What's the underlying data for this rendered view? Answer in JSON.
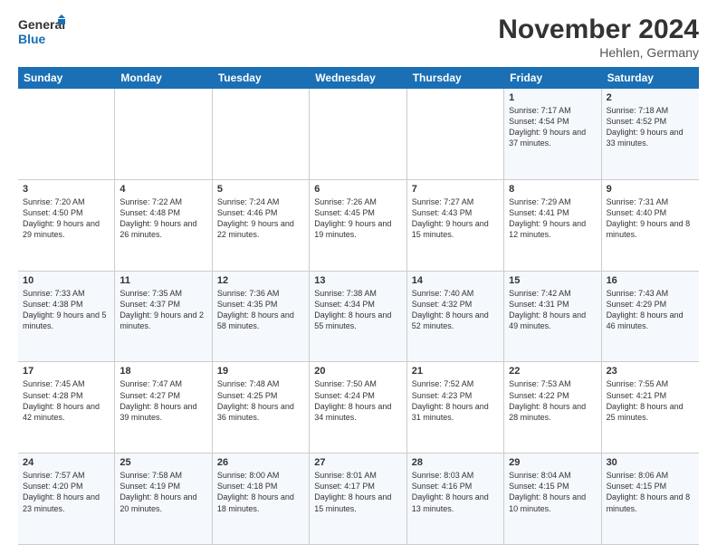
{
  "logo": {
    "line1": "General",
    "line2": "Blue"
  },
  "title": "November 2024",
  "location": "Hehlen, Germany",
  "headers": [
    "Sunday",
    "Monday",
    "Tuesday",
    "Wednesday",
    "Thursday",
    "Friday",
    "Saturday"
  ],
  "rows": [
    [
      {
        "day": "",
        "info": ""
      },
      {
        "day": "",
        "info": ""
      },
      {
        "day": "",
        "info": ""
      },
      {
        "day": "",
        "info": ""
      },
      {
        "day": "",
        "info": ""
      },
      {
        "day": "1",
        "info": "Sunrise: 7:17 AM\nSunset: 4:54 PM\nDaylight: 9 hours and 37 minutes."
      },
      {
        "day": "2",
        "info": "Sunrise: 7:18 AM\nSunset: 4:52 PM\nDaylight: 9 hours and 33 minutes."
      }
    ],
    [
      {
        "day": "3",
        "info": "Sunrise: 7:20 AM\nSunset: 4:50 PM\nDaylight: 9 hours and 29 minutes."
      },
      {
        "day": "4",
        "info": "Sunrise: 7:22 AM\nSunset: 4:48 PM\nDaylight: 9 hours and 26 minutes."
      },
      {
        "day": "5",
        "info": "Sunrise: 7:24 AM\nSunset: 4:46 PM\nDaylight: 9 hours and 22 minutes."
      },
      {
        "day": "6",
        "info": "Sunrise: 7:26 AM\nSunset: 4:45 PM\nDaylight: 9 hours and 19 minutes."
      },
      {
        "day": "7",
        "info": "Sunrise: 7:27 AM\nSunset: 4:43 PM\nDaylight: 9 hours and 15 minutes."
      },
      {
        "day": "8",
        "info": "Sunrise: 7:29 AM\nSunset: 4:41 PM\nDaylight: 9 hours and 12 minutes."
      },
      {
        "day": "9",
        "info": "Sunrise: 7:31 AM\nSunset: 4:40 PM\nDaylight: 9 hours and 8 minutes."
      }
    ],
    [
      {
        "day": "10",
        "info": "Sunrise: 7:33 AM\nSunset: 4:38 PM\nDaylight: 9 hours and 5 minutes."
      },
      {
        "day": "11",
        "info": "Sunrise: 7:35 AM\nSunset: 4:37 PM\nDaylight: 9 hours and 2 minutes."
      },
      {
        "day": "12",
        "info": "Sunrise: 7:36 AM\nSunset: 4:35 PM\nDaylight: 8 hours and 58 minutes."
      },
      {
        "day": "13",
        "info": "Sunrise: 7:38 AM\nSunset: 4:34 PM\nDaylight: 8 hours and 55 minutes."
      },
      {
        "day": "14",
        "info": "Sunrise: 7:40 AM\nSunset: 4:32 PM\nDaylight: 8 hours and 52 minutes."
      },
      {
        "day": "15",
        "info": "Sunrise: 7:42 AM\nSunset: 4:31 PM\nDaylight: 8 hours and 49 minutes."
      },
      {
        "day": "16",
        "info": "Sunrise: 7:43 AM\nSunset: 4:29 PM\nDaylight: 8 hours and 46 minutes."
      }
    ],
    [
      {
        "day": "17",
        "info": "Sunrise: 7:45 AM\nSunset: 4:28 PM\nDaylight: 8 hours and 42 minutes."
      },
      {
        "day": "18",
        "info": "Sunrise: 7:47 AM\nSunset: 4:27 PM\nDaylight: 8 hours and 39 minutes."
      },
      {
        "day": "19",
        "info": "Sunrise: 7:48 AM\nSunset: 4:25 PM\nDaylight: 8 hours and 36 minutes."
      },
      {
        "day": "20",
        "info": "Sunrise: 7:50 AM\nSunset: 4:24 PM\nDaylight: 8 hours and 34 minutes."
      },
      {
        "day": "21",
        "info": "Sunrise: 7:52 AM\nSunset: 4:23 PM\nDaylight: 8 hours and 31 minutes."
      },
      {
        "day": "22",
        "info": "Sunrise: 7:53 AM\nSunset: 4:22 PM\nDaylight: 8 hours and 28 minutes."
      },
      {
        "day": "23",
        "info": "Sunrise: 7:55 AM\nSunset: 4:21 PM\nDaylight: 8 hours and 25 minutes."
      }
    ],
    [
      {
        "day": "24",
        "info": "Sunrise: 7:57 AM\nSunset: 4:20 PM\nDaylight: 8 hours and 23 minutes."
      },
      {
        "day": "25",
        "info": "Sunrise: 7:58 AM\nSunset: 4:19 PM\nDaylight: 8 hours and 20 minutes."
      },
      {
        "day": "26",
        "info": "Sunrise: 8:00 AM\nSunset: 4:18 PM\nDaylight: 8 hours and 18 minutes."
      },
      {
        "day": "27",
        "info": "Sunrise: 8:01 AM\nSunset: 4:17 PM\nDaylight: 8 hours and 15 minutes."
      },
      {
        "day": "28",
        "info": "Sunrise: 8:03 AM\nSunset: 4:16 PM\nDaylight: 8 hours and 13 minutes."
      },
      {
        "day": "29",
        "info": "Sunrise: 8:04 AM\nSunset: 4:15 PM\nDaylight: 8 hours and 10 minutes."
      },
      {
        "day": "30",
        "info": "Sunrise: 8:06 AM\nSunset: 4:15 PM\nDaylight: 8 hours and 8 minutes."
      }
    ]
  ]
}
